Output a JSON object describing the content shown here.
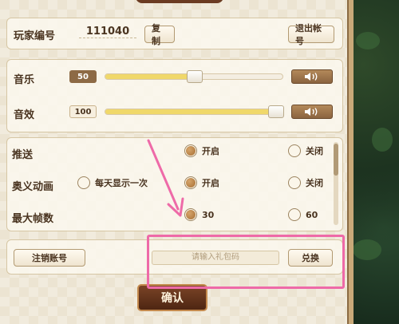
{
  "player": {
    "id_label": "玩家编号",
    "id_value": "111040",
    "copy_button": "复制",
    "logout_button": "退出帐号"
  },
  "audio": {
    "music_label": "音乐",
    "music_value": "50",
    "music_level": 0.5,
    "sfx_label": "音效",
    "sfx_value": "100",
    "sfx_level": 1.0
  },
  "options": {
    "push_label": "推送",
    "ultimate_label": "奥义动画",
    "fps_label": "最大帧数",
    "on": "开启",
    "off": "关闭",
    "daily_once": "每天显示一次",
    "fps_30": "30",
    "fps_60": "60"
  },
  "account": {
    "cancel_account_button": "注销账号",
    "gift_placeholder": "请输入礼包码",
    "redeem_button": "兑换"
  },
  "confirm_button": "确认",
  "colors": {
    "panel_bg": "#ece4d2",
    "accent_brown": "#8d6a45",
    "slider_fill": "#f0d86a",
    "annotation_pink": "#ee6aa8"
  }
}
